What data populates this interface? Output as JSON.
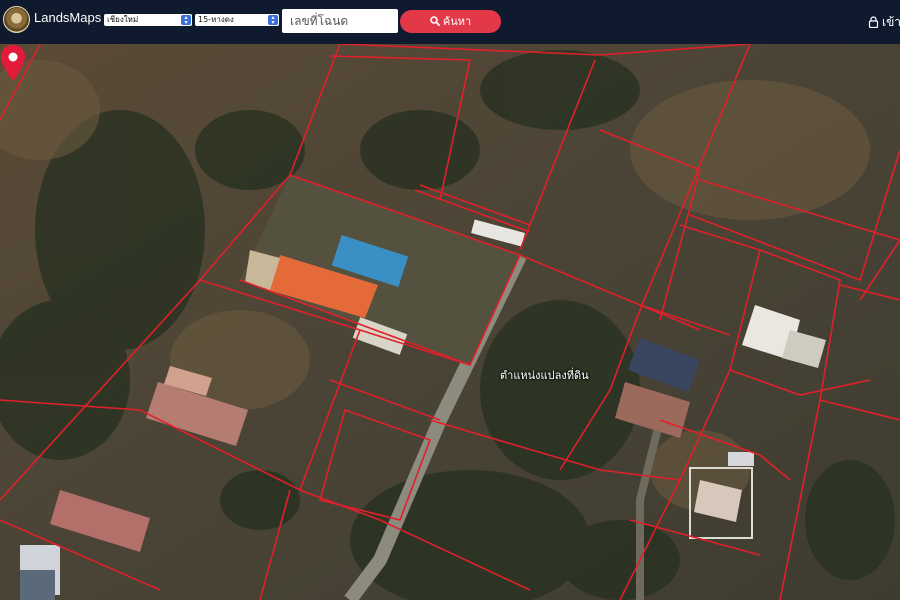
{
  "header": {
    "brand": "LandsMaps",
    "province_select": "เชียงใหม่",
    "district_select": "15-หางดง",
    "deed_input_placeholder": "เลขที่โฉนด",
    "search_label": "ค้นหา",
    "login_label": "เข้าสู่"
  },
  "map": {
    "pin_label": "ตำแหน่งแปลงที่ดิน",
    "boundary_color": "#e0202a",
    "pin_color": "#e31b3a"
  },
  "icons": {
    "logo": "department-of-lands-emblem",
    "search": "search-icon",
    "login": "lock-icon",
    "pin": "map-pin-icon"
  }
}
